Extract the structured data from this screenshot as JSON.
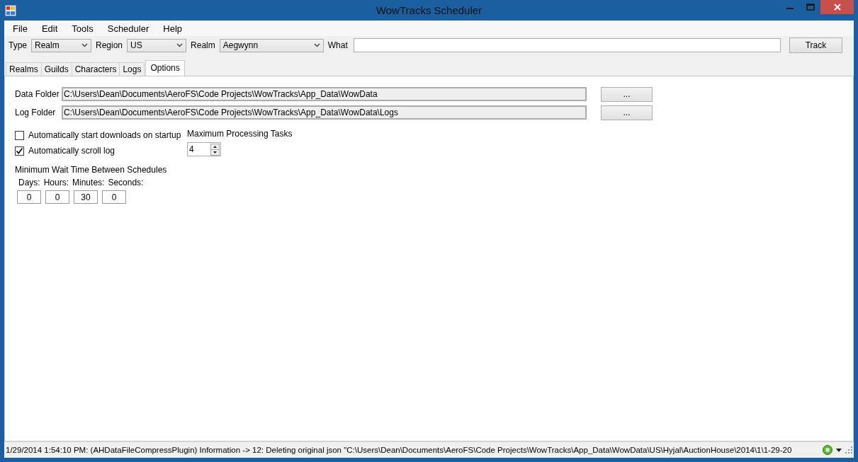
{
  "window": {
    "title": "WowTracks Scheduler"
  },
  "menu": [
    "File",
    "Edit",
    "Tools",
    "Scheduler",
    "Help"
  ],
  "toolbar": {
    "selects": [
      {
        "label": "Type",
        "value": "Realm"
      },
      {
        "label": "Region",
        "value": "US"
      },
      {
        "label": "Realm",
        "value": "Aegwynn"
      }
    ],
    "what": {
      "label": "What"
    },
    "button": "Track"
  },
  "tabs": [
    {
      "label": "Realms",
      "selected": false
    },
    {
      "label": "Guilds",
      "selected": false
    },
    {
      "label": "Characters",
      "selected": false
    },
    {
      "label": "Logs",
      "selected": false
    },
    {
      "label": "Options",
      "selected": true
    }
  ],
  "options": {
    "folders": [
      {
        "label": "Data Folder",
        "value": "C:\\Users\\Dean\\Documents\\AeroFS\\Code Projects\\WowTracks\\App_Data\\WowData",
        "button": "..."
      },
      {
        "label": "Log Folder",
        "value": "C:\\Users\\Dean\\Documents\\AeroFS\\Code Projects\\WowTracks\\App_Data\\WowData\\Logs",
        "button": "..."
      }
    ],
    "checkboxes": [
      {
        "label": "Automatically start downloads on startup",
        "checked": false
      },
      {
        "label": "Automatically scroll log",
        "checked": true
      }
    ],
    "max_tasks": {
      "label": "Maximum Processing Tasks",
      "value": "4"
    },
    "wait": {
      "label": "Minimum Wait Time Between Schedules",
      "units": [
        {
          "label": "Days:",
          "value": "0"
        },
        {
          "label": "Hours:",
          "value": "0"
        },
        {
          "label": "Minutes:",
          "value": "30"
        },
        {
          "label": "Seconds:",
          "value": "0"
        }
      ]
    }
  },
  "status_bar": {
    "text": "1/29/2014 1:54:10 PM: (AHDataFileCompressPlugin) Information -> 12: Deleting original json \"C:\\Users\\Dean\\Documents\\AeroFS\\Code Projects\\WowTracks\\App_Data\\WowData\\US\\Hyjal\\AuctionHouse\\2014\\1\\1-29-20"
  }
}
